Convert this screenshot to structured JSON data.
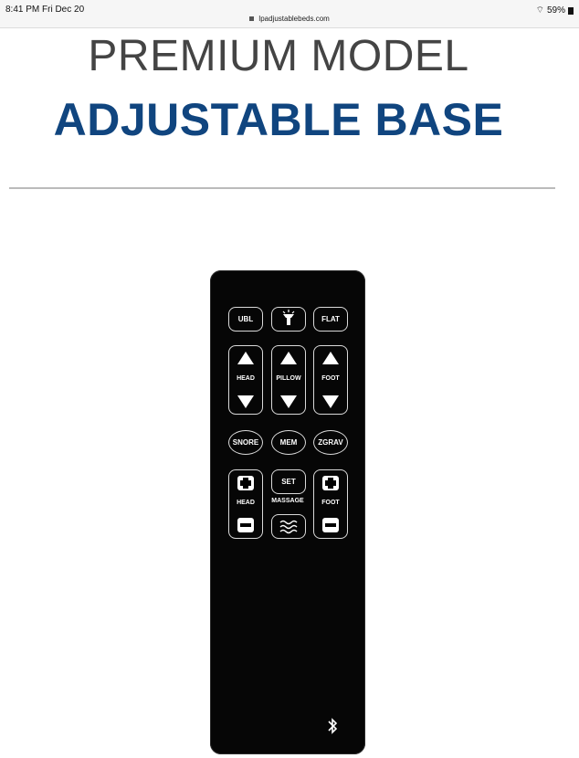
{
  "status": {
    "time": "8:41 PM  Fri Dec 20",
    "url": "lpadjustablebeds.com",
    "battery": "59%"
  },
  "heading": {
    "line1": "PREMIUM MODEL",
    "line2": "ADJUSTABLE BASE"
  },
  "remote": {
    "buttons": {
      "ubl": "UBL",
      "flat": "FLAT",
      "pillow_label": "PILLOW",
      "head_label": "HEAD",
      "foot_label": "FOOT",
      "snore": "SNORE",
      "mem": "MEM",
      "zgrav": "ZGRAV",
      "set": "SET",
      "massage_label": "MASSAGE",
      "massage_head_label": "HEAD",
      "massage_foot_label": "FOOT"
    }
  }
}
